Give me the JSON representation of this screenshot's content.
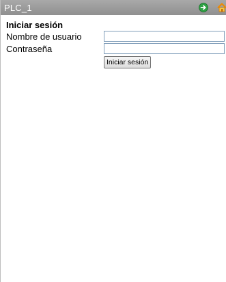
{
  "window": {
    "title": "PLC_1",
    "icons": [
      "next-arrow-icon",
      "home-icon"
    ],
    "colors": {
      "titlebar": "#999999",
      "next_icon": "#2ea043",
      "home_icon": "#f08a00"
    }
  },
  "login": {
    "heading": "Iniciar sesión",
    "username_label": "Nombre de usuario",
    "username_value": "",
    "password_label": "Contraseña",
    "password_value": "",
    "submit_label": "Iniciar sesión"
  }
}
